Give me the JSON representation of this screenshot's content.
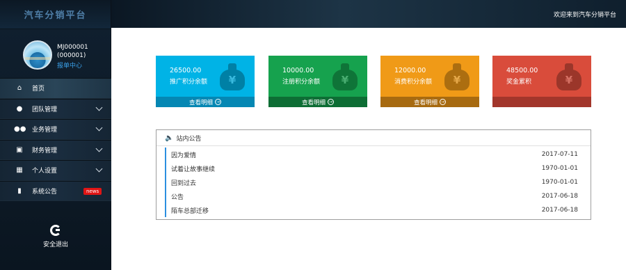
{
  "app": {
    "title": "汽车分销平台",
    "welcome": "欢迎来到汽车分销平台"
  },
  "profile": {
    "name_line1": "MJ000001",
    "name_line2": "(000001)",
    "link": "报单中心"
  },
  "menu": [
    {
      "label": "首页",
      "icon": "home-icon",
      "active": true
    },
    {
      "label": "团队管理",
      "icon": "user-icon",
      "expandable": true
    },
    {
      "label": "业务管理",
      "icon": "users-icon",
      "expandable": true
    },
    {
      "label": "财务管理",
      "icon": "finance-icon",
      "expandable": true
    },
    {
      "label": "个人设置",
      "icon": "settings-icon",
      "expandable": true
    },
    {
      "label": "系统公告",
      "icon": "speaker-icon",
      "badge": "news"
    }
  ],
  "logout": {
    "label": "安全退出",
    "icon": "power-icon"
  },
  "cards": [
    {
      "amount": "26500.00",
      "label": "推广积分余额",
      "footer": "查看明细",
      "color": "#00b3e6",
      "foot_color": "#0587b3"
    },
    {
      "amount": "10000.00",
      "label": "注册积分余额",
      "footer": "查看明细",
      "color": "#16a24e",
      "foot_color": "#0d6d34"
    },
    {
      "amount": "12000.00",
      "label": "消费积分余额",
      "footer": "查看明细",
      "color": "#f09a17",
      "foot_color": "#a76a10"
    },
    {
      "amount": "48500.00",
      "label": "奖金累积",
      "footer": "",
      "color": "#d94c3b",
      "foot_color": "#a2362b"
    }
  ],
  "notices": {
    "title": "站内公告",
    "items": [
      {
        "title": "因为爱情",
        "date": "2017-07-11"
      },
      {
        "title": "试着让故事继续",
        "date": "1970-01-01"
      },
      {
        "title": "回到过去",
        "date": "1970-01-01"
      },
      {
        "title": "公告",
        "date": "2017-06-18"
      },
      {
        "title": "陌车总部迁移",
        "date": "2017-06-18"
      }
    ]
  }
}
